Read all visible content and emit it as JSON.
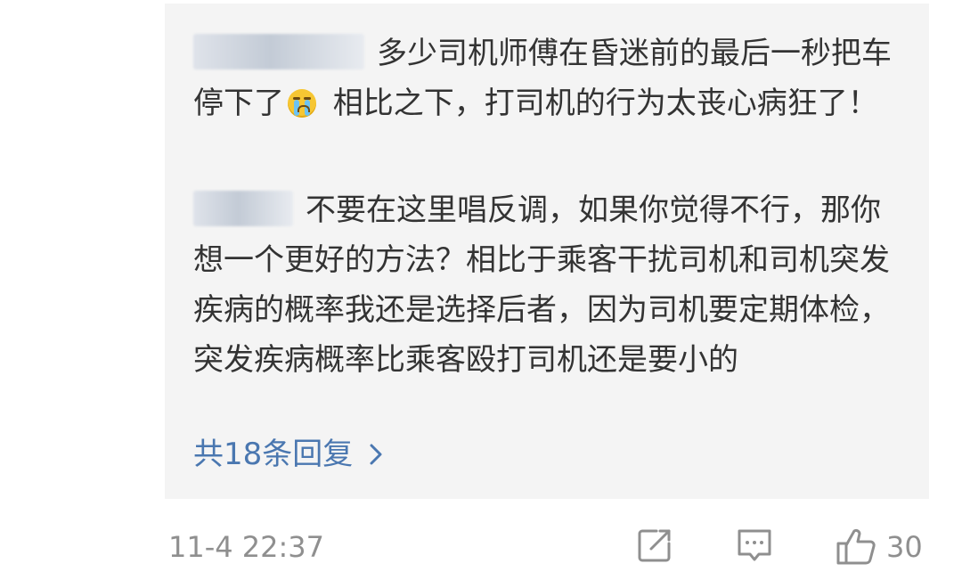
{
  "replies": [
    {
      "text_before": "多少司机师傅在昏迷前的最后一秒把车停下了",
      "emoji": "crying-face",
      "text_after": " 相比之下，打司机的行为太丧心病狂了！"
    },
    {
      "text": "不要在这里唱反调，如果你觉得不行，那你想一个更好的方法？相比于乘客干扰司机和司机突发疾病的概率我还是选择后者，因为司机要定期体检，突发疾病概率比乘客殴打司机还是要小的"
    }
  ],
  "more_replies_label": "共18条回复",
  "footer": {
    "timestamp": "11-4 22:37",
    "like_count": "30"
  },
  "colors": {
    "link": "#4a77b0",
    "meta": "#8f8f8f",
    "text": "#333333",
    "reply_bg": "#f4f4f4"
  }
}
